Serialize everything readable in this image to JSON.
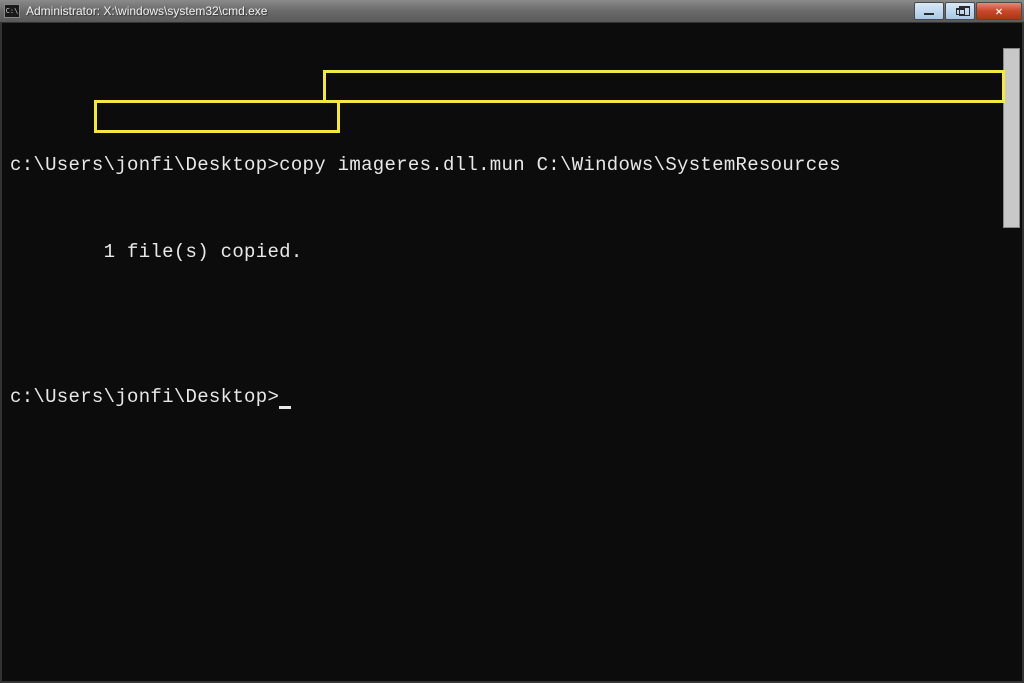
{
  "window": {
    "title": "Administrator: X:\\windows\\system32\\cmd.exe",
    "icon_label": "C:\\"
  },
  "terminal": {
    "lines": {
      "blank1": "",
      "prompt1": "c:\\Users\\jonfi\\Desktop>",
      "command1": "copy imageres.dll.mun C:\\Windows\\SystemResources",
      "result_indent": "        ",
      "result": "1 file(s) copied.",
      "blank2": "",
      "prompt2": "c:\\Users\\jonfi\\Desktop>"
    }
  },
  "controls": {
    "minimize_label": "Minimize",
    "maximize_label": "Restore",
    "close_label": "Close"
  },
  "highlight": {
    "color": "#f3e842"
  }
}
